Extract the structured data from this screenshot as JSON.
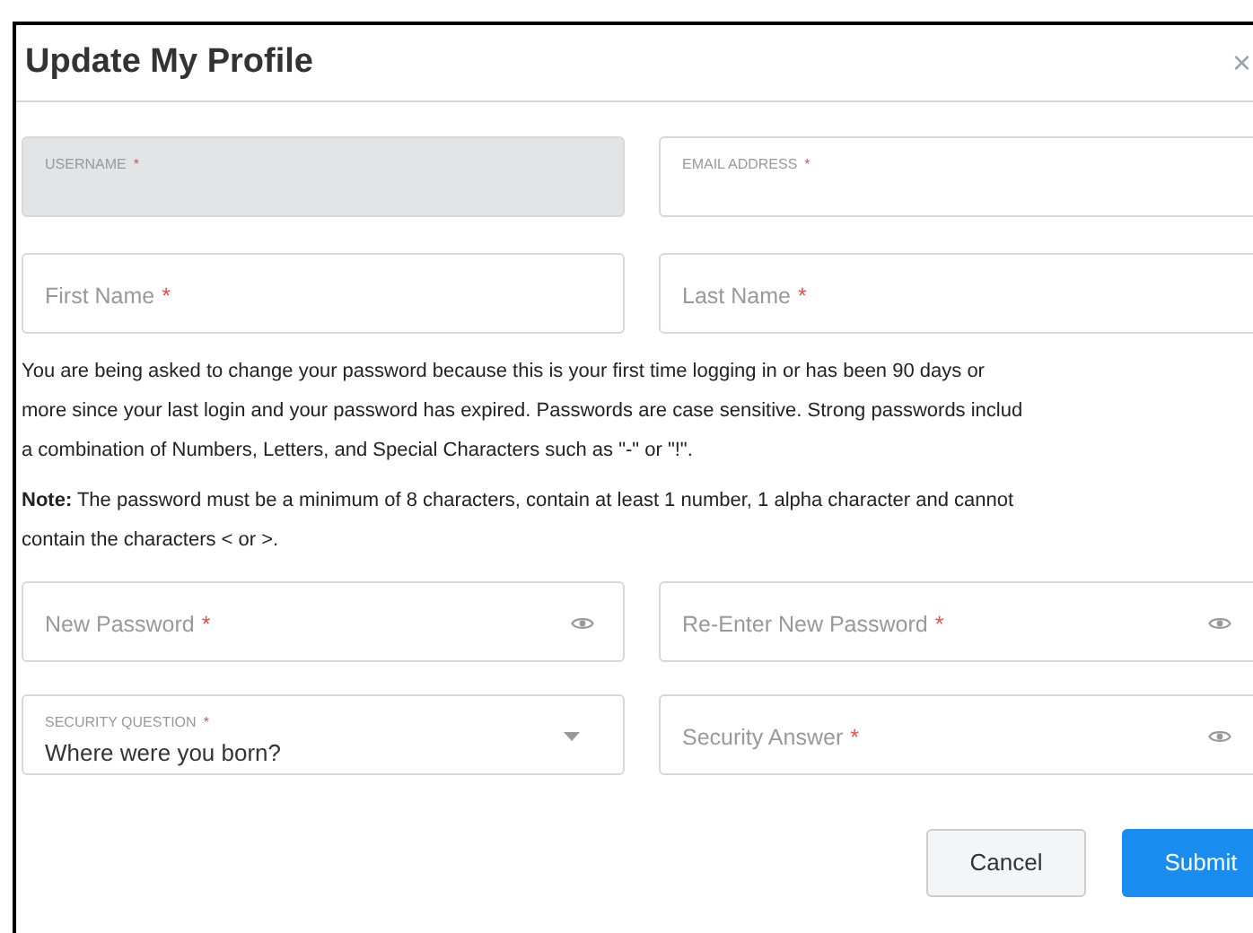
{
  "dialog": {
    "title": "Update My Profile",
    "close": "×"
  },
  "fields_top": [
    {
      "kind": "floating",
      "label": "USERNAME",
      "required_mark": "*",
      "disabled": true
    },
    {
      "kind": "floating",
      "label": "EMAIL ADDRESS",
      "required_mark": "*",
      "disabled": false
    },
    {
      "kind": "text",
      "placeholder": "First Name",
      "required_mark": "*",
      "disabled": false
    },
    {
      "kind": "text",
      "placeholder": "Last Name",
      "required_mark": "*",
      "disabled": false
    }
  ],
  "info_lines": [
    "You are being asked to change your password because this is your first time logging in or has been 90 days or",
    "more since your last login and your password has expired. Passwords are case sensitive. Strong passwords includ",
    "a combination of Numbers, Letters, and Special Characters such as \"-\" or \"!\"."
  ],
  "note_lines": [
    "**Note:** The password must be a minimum of 8 characters, contain at least 1 number, 1 alpha character and cannot",
    "contain the characters < or >."
  ],
  "fields_bottom": [
    {
      "kind": "password",
      "placeholder": "New Password",
      "required_mark": "*",
      "disabled": false
    },
    {
      "kind": "password",
      "placeholder": "Re-Enter New Password",
      "required_mark": "*",
      "disabled": false
    },
    {
      "kind": "select",
      "label": "SECURITY QUESTION",
      "value": "Where were you born?",
      "required_mark": "*",
      "disabled": false
    },
    {
      "kind": "password",
      "placeholder": "Security Answer",
      "required_mark": "*",
      "disabled": false
    }
  ],
  "buttons": [
    {
      "label": "Cancel",
      "kind": "secondary"
    },
    {
      "label": "Submit",
      "kind": "primary"
    }
  ]
}
